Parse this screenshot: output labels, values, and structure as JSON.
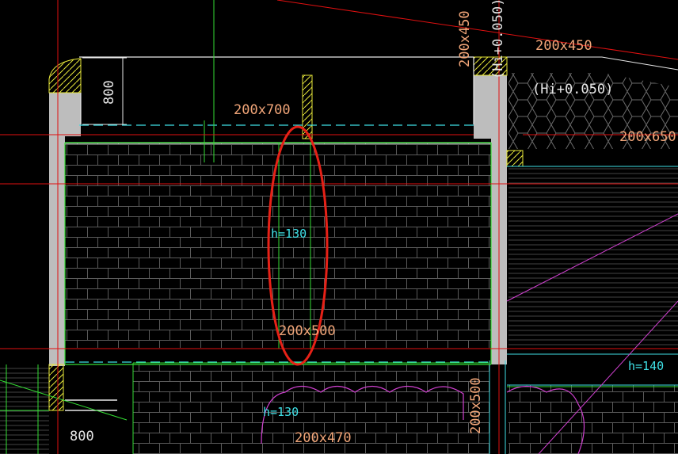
{
  "dimensions": {
    "beam_top_right_vertical": "200x450",
    "beam_top_right": "200x450",
    "elevation_vertical": "(Hi+0.050)",
    "elevation_hatch": "(Hi+0.050)",
    "beam_top_mid": "200x700",
    "beam_right": "200x650",
    "beam_center_vertical": "200x500",
    "beam_bottom_right_vertical": "200x500",
    "beam_bottom": "200x470",
    "dim_800_left": "800",
    "dim_800_bottom": "800"
  },
  "heights": {
    "center": "h=130",
    "bottom_left": "h=130",
    "right": "h=140"
  },
  "colors": {
    "background": "#000000",
    "hatch": "#5a5a5a",
    "wall_fill": "#bdbdbd",
    "cyan": "#3fe0e6",
    "green": "#33dd33",
    "red_axis": "#e01010",
    "yellow": "#e8e83a",
    "magenta": "#d040d0",
    "highlight_ellipse": "#e62117",
    "orange_text": "#f2a679"
  }
}
